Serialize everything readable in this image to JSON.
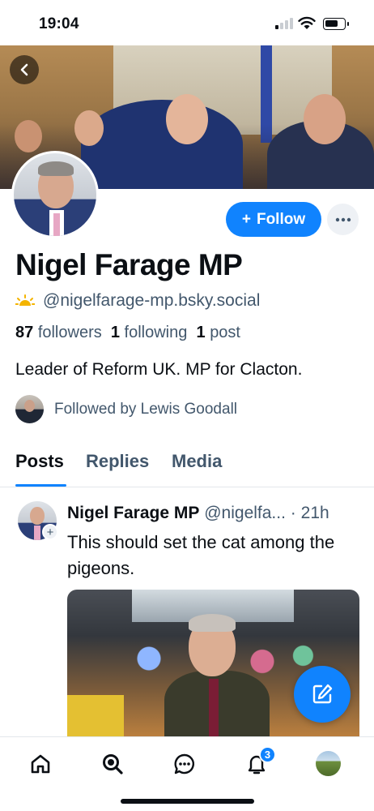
{
  "status_bar": {
    "time": "19:04",
    "signal_icon": "signal-icon",
    "wifi_icon": "wifi-icon",
    "battery_icon": "battery-icon"
  },
  "profile": {
    "display_name": "Nigel Farage MP",
    "handle": "@nigelfarage-mp.bsky.social",
    "handle_icon": "sun-icon",
    "stats": {
      "followers_count": "87",
      "followers_label": "followers",
      "following_count": "1",
      "following_label": "following",
      "posts_count": "1",
      "posts_label": "post"
    },
    "bio": "Leader of Reform UK. MP for Clacton.",
    "followed_by": "Followed by Lewis Goodall",
    "follow_label": "Follow",
    "follow_prefix": "+"
  },
  "tabs": [
    {
      "label": "Posts",
      "active": true
    },
    {
      "label": "Replies",
      "active": false
    },
    {
      "label": "Media",
      "active": false
    }
  ],
  "post": {
    "author": "Nigel Farage MP",
    "handle": "@nigelfa...",
    "separator": "·",
    "time": "21h",
    "text": "This should set the cat among the pigeons."
  },
  "bottom_nav": {
    "items": [
      "home-icon",
      "search-icon",
      "chat-icon",
      "bell-icon",
      "avatar"
    ],
    "notifications_badge": "3"
  },
  "colors": {
    "accent": "#1083fe",
    "muted_text": "#42576c",
    "text": "#0b0f14"
  }
}
